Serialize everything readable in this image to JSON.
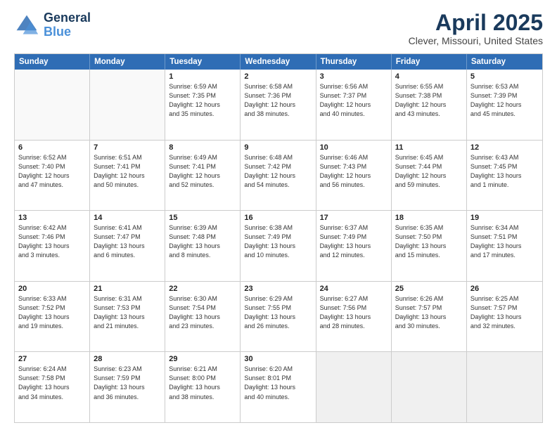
{
  "header": {
    "logo_line1": "General",
    "logo_line2": "Blue",
    "month": "April 2025",
    "location": "Clever, Missouri, United States"
  },
  "days_of_week": [
    "Sunday",
    "Monday",
    "Tuesday",
    "Wednesday",
    "Thursday",
    "Friday",
    "Saturday"
  ],
  "weeks": [
    [
      {
        "day": "",
        "info": ""
      },
      {
        "day": "",
        "info": ""
      },
      {
        "day": "1",
        "info": "Sunrise: 6:59 AM\nSunset: 7:35 PM\nDaylight: 12 hours\nand 35 minutes."
      },
      {
        "day": "2",
        "info": "Sunrise: 6:58 AM\nSunset: 7:36 PM\nDaylight: 12 hours\nand 38 minutes."
      },
      {
        "day": "3",
        "info": "Sunrise: 6:56 AM\nSunset: 7:37 PM\nDaylight: 12 hours\nand 40 minutes."
      },
      {
        "day": "4",
        "info": "Sunrise: 6:55 AM\nSunset: 7:38 PM\nDaylight: 12 hours\nand 43 minutes."
      },
      {
        "day": "5",
        "info": "Sunrise: 6:53 AM\nSunset: 7:39 PM\nDaylight: 12 hours\nand 45 minutes."
      }
    ],
    [
      {
        "day": "6",
        "info": "Sunrise: 6:52 AM\nSunset: 7:40 PM\nDaylight: 12 hours\nand 47 minutes."
      },
      {
        "day": "7",
        "info": "Sunrise: 6:51 AM\nSunset: 7:41 PM\nDaylight: 12 hours\nand 50 minutes."
      },
      {
        "day": "8",
        "info": "Sunrise: 6:49 AM\nSunset: 7:41 PM\nDaylight: 12 hours\nand 52 minutes."
      },
      {
        "day": "9",
        "info": "Sunrise: 6:48 AM\nSunset: 7:42 PM\nDaylight: 12 hours\nand 54 minutes."
      },
      {
        "day": "10",
        "info": "Sunrise: 6:46 AM\nSunset: 7:43 PM\nDaylight: 12 hours\nand 56 minutes."
      },
      {
        "day": "11",
        "info": "Sunrise: 6:45 AM\nSunset: 7:44 PM\nDaylight: 12 hours\nand 59 minutes."
      },
      {
        "day": "12",
        "info": "Sunrise: 6:43 AM\nSunset: 7:45 PM\nDaylight: 13 hours\nand 1 minute."
      }
    ],
    [
      {
        "day": "13",
        "info": "Sunrise: 6:42 AM\nSunset: 7:46 PM\nDaylight: 13 hours\nand 3 minutes."
      },
      {
        "day": "14",
        "info": "Sunrise: 6:41 AM\nSunset: 7:47 PM\nDaylight: 13 hours\nand 6 minutes."
      },
      {
        "day": "15",
        "info": "Sunrise: 6:39 AM\nSunset: 7:48 PM\nDaylight: 13 hours\nand 8 minutes."
      },
      {
        "day": "16",
        "info": "Sunrise: 6:38 AM\nSunset: 7:49 PM\nDaylight: 13 hours\nand 10 minutes."
      },
      {
        "day": "17",
        "info": "Sunrise: 6:37 AM\nSunset: 7:49 PM\nDaylight: 13 hours\nand 12 minutes."
      },
      {
        "day": "18",
        "info": "Sunrise: 6:35 AM\nSunset: 7:50 PM\nDaylight: 13 hours\nand 15 minutes."
      },
      {
        "day": "19",
        "info": "Sunrise: 6:34 AM\nSunset: 7:51 PM\nDaylight: 13 hours\nand 17 minutes."
      }
    ],
    [
      {
        "day": "20",
        "info": "Sunrise: 6:33 AM\nSunset: 7:52 PM\nDaylight: 13 hours\nand 19 minutes."
      },
      {
        "day": "21",
        "info": "Sunrise: 6:31 AM\nSunset: 7:53 PM\nDaylight: 13 hours\nand 21 minutes."
      },
      {
        "day": "22",
        "info": "Sunrise: 6:30 AM\nSunset: 7:54 PM\nDaylight: 13 hours\nand 23 minutes."
      },
      {
        "day": "23",
        "info": "Sunrise: 6:29 AM\nSunset: 7:55 PM\nDaylight: 13 hours\nand 26 minutes."
      },
      {
        "day": "24",
        "info": "Sunrise: 6:27 AM\nSunset: 7:56 PM\nDaylight: 13 hours\nand 28 minutes."
      },
      {
        "day": "25",
        "info": "Sunrise: 6:26 AM\nSunset: 7:57 PM\nDaylight: 13 hours\nand 30 minutes."
      },
      {
        "day": "26",
        "info": "Sunrise: 6:25 AM\nSunset: 7:57 PM\nDaylight: 13 hours\nand 32 minutes."
      }
    ],
    [
      {
        "day": "27",
        "info": "Sunrise: 6:24 AM\nSunset: 7:58 PM\nDaylight: 13 hours\nand 34 minutes."
      },
      {
        "day": "28",
        "info": "Sunrise: 6:23 AM\nSunset: 7:59 PM\nDaylight: 13 hours\nand 36 minutes."
      },
      {
        "day": "29",
        "info": "Sunrise: 6:21 AM\nSunset: 8:00 PM\nDaylight: 13 hours\nand 38 minutes."
      },
      {
        "day": "30",
        "info": "Sunrise: 6:20 AM\nSunset: 8:01 PM\nDaylight: 13 hours\nand 40 minutes."
      },
      {
        "day": "",
        "info": ""
      },
      {
        "day": "",
        "info": ""
      },
      {
        "day": "",
        "info": ""
      }
    ]
  ]
}
